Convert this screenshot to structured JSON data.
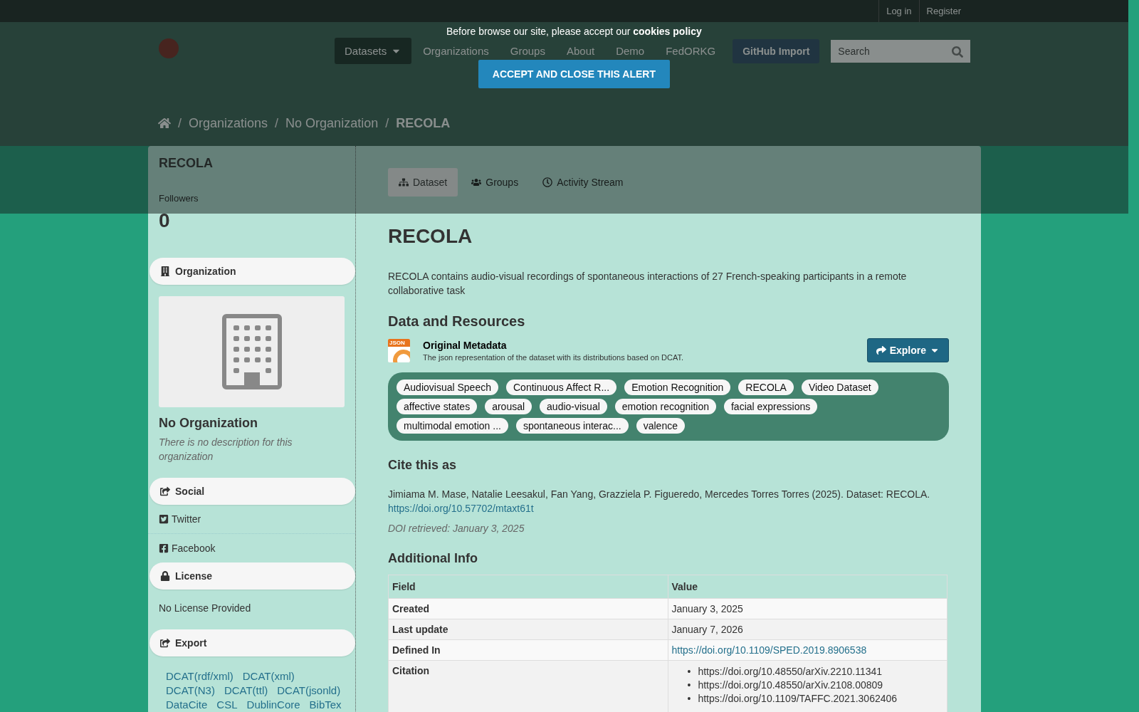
{
  "cookie_banner": {
    "message": "Before browse our site, please accept our **cookies policy**",
    "button": "ACCEPT AND CLOSE THIS ALERT"
  },
  "top_bar": {
    "links": [
      "Log in",
      "Register"
    ]
  },
  "nav": {
    "items": [
      {
        "label": "Datasets",
        "selected": true,
        "dropdown": true
      },
      {
        "label": "Organizations",
        "selected": false,
        "dropdown": false
      },
      {
        "label": "Groups",
        "selected": false,
        "dropdown": false
      },
      {
        "label": "About",
        "selected": false,
        "dropdown": false
      },
      {
        "label": "Demo",
        "selected": false,
        "dropdown": false
      },
      {
        "label": "FedORKG",
        "selected": false,
        "dropdown": false
      }
    ],
    "github_button": "GitHub Import",
    "search": {
      "placeholder": "Search"
    }
  },
  "breadcrumb": {
    "separator": "/",
    "items": [
      "Organizations",
      "No Organization",
      "RECOLA"
    ]
  },
  "sidebar": {
    "title": "RECOLA",
    "followers_label": "Followers",
    "followers_count": "0",
    "sections": [
      {
        "kind": "organization",
        "heading": "Organization",
        "name": "No Organization",
        "description": "There is no description for this organization"
      },
      {
        "kind": "social",
        "heading": "Social",
        "links": [
          "Twitter",
          "Facebook"
        ]
      },
      {
        "kind": "license",
        "heading": "License",
        "text": "No License Provided"
      },
      {
        "kind": "export",
        "heading": "Export",
        "links": [
          "DCAT(rdf/xml)",
          "DCAT(xml)",
          "DCAT(N3)",
          "DCAT(ttl)",
          "DCAT(jsonld)",
          "DataCite",
          "CSL",
          "DublinCore",
          "BibTex"
        ]
      }
    ]
  },
  "tabs": [
    {
      "label": "Dataset",
      "selected": true
    },
    {
      "label": "Groups",
      "selected": false
    },
    {
      "label": "Activity Stream",
      "selected": false
    }
  ],
  "dataset": {
    "title": "RECOLA",
    "description": "RECOLA contains audio-visual recordings of spontaneous interactions of 27 French-speaking participants in a remote collaborative task",
    "resources_heading": "Data and Resources",
    "resources": [
      {
        "name": "Original Metadata",
        "description": "The json representation of the dataset with its distributions based on DCAT.",
        "format": "JSON",
        "action": "Explore"
      }
    ],
    "tags": [
      "Audiovisual Speech",
      "Continuous Affect R...",
      "Emotion Recognition",
      "RECOLA",
      "Video Dataset",
      "affective states",
      "arousal",
      "audio-visual",
      "emotion recognition",
      "facial expressions",
      "multimodal emotion ...",
      "spontaneous interac...",
      "valence"
    ],
    "cite_heading": "Cite this as",
    "citation": "Jimiama M. Mase, Natalie Leesakul, Fan Yang, Grazziela P. Figueredo, Mercedes Torres Torres (2025). Dataset: RECOLA.",
    "citation_link": "https://doi.org/10.57702/mtaxt61t",
    "doi_note": "DOI retrieved: January 3, 2025",
    "info_heading": "Additional Info",
    "table": {
      "columns": [
        "Field",
        "Value"
      ],
      "rows": [
        {
          "field": "Created",
          "kind": "text",
          "value": "January 3, 2025"
        },
        {
          "field": "Last update",
          "kind": "text",
          "value": "January 7, 2026"
        },
        {
          "field": "Defined In",
          "kind": "link",
          "value": "https://doi.org/10.1109/SPED.2019.8906538"
        },
        {
          "field": "Citation",
          "kind": "list",
          "marker": "•",
          "values": [
            "https://doi.org/10.48550/arXiv.2210.11341",
            "https://doi.org/10.48550/arXiv.2108.00809",
            "https://doi.org/10.1109/TAFFC.2021.3062406"
          ]
        }
      ]
    }
  }
}
